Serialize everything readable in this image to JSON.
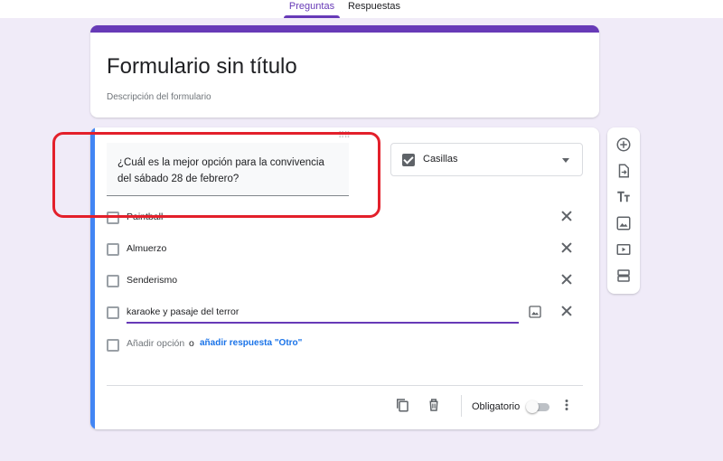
{
  "tabs": [
    {
      "label": "Preguntas",
      "active": true
    },
    {
      "label": "Respuestas",
      "active": false
    }
  ],
  "accent_color": "#673ab7",
  "question_accent_color": "#4285f4",
  "form": {
    "title": "Formulario sin título",
    "description_placeholder": "Descripción del formulario"
  },
  "question": {
    "text": "¿Cuál es la mejor opción para la convivencia del sábado 28 de febrero?",
    "type": {
      "label": "Casillas",
      "icon": "checkbox-icon"
    },
    "options": [
      {
        "label": "Paintball"
      },
      {
        "label": "Almuerzo"
      },
      {
        "label": "Senderismo"
      },
      {
        "label": "karaoke y pasaje del terror"
      }
    ],
    "add_option_label": "Añadir opción",
    "or_label": "o",
    "add_other_label": "añadir respuesta \"Otro\"",
    "required_label": "Obligatorio",
    "required": false
  },
  "toolbar": {
    "icons": [
      "add-question-icon",
      "import-questions-icon",
      "add-title-icon",
      "add-image-icon",
      "add-video-icon",
      "add-section-icon"
    ]
  },
  "footer_icons": [
    "duplicate-icon",
    "delete-icon",
    "more-options-icon"
  ],
  "highlight_color": "#e3202b"
}
